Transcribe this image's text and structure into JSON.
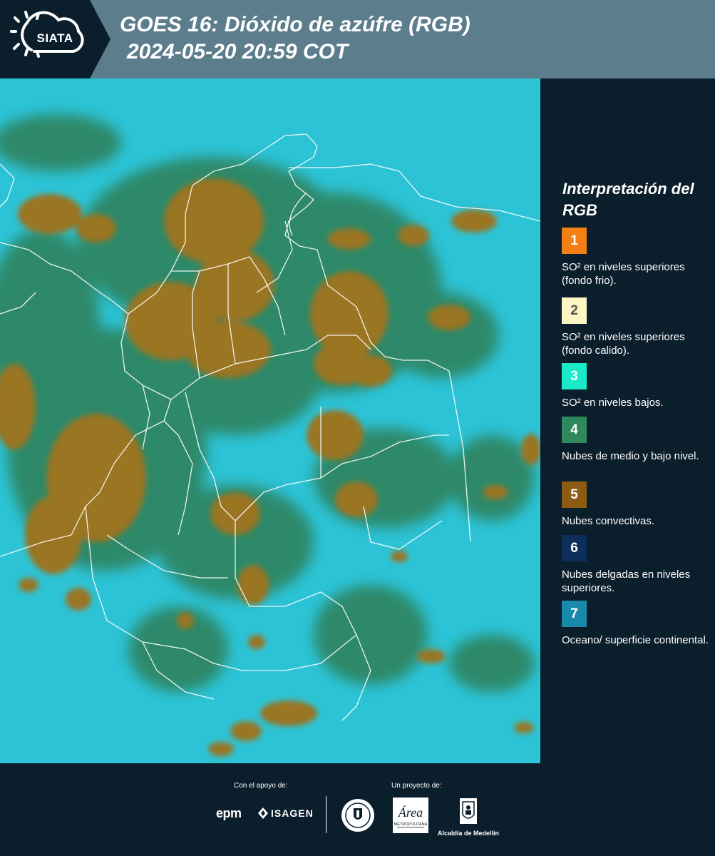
{
  "header": {
    "logo_text": "SIATA",
    "title": "GOES 16: Dióxido de azúfre (RGB)",
    "subtitle": "2024-05-20 20:59 COT"
  },
  "legend": {
    "title": "Interpretación del RGB",
    "items": [
      {
        "number": "1",
        "label": "SO² en niveles superiores (fondo frio).",
        "color": "#f47f14",
        "text_color": "#ffffff"
      },
      {
        "number": "2",
        "label": "SO² en niveles superiores (fondo calido).",
        "color": "#fbf6c2",
        "text_color": "#555555"
      },
      {
        "number": "3",
        "label": "SO² en niveles bajos.",
        "color": "#19ebc8",
        "text_color": "#ffffff"
      },
      {
        "number": "4",
        "label": "Nubes de medio y bajo nivel.",
        "color": "#2e8a5c",
        "text_color": "#ffffff"
      },
      {
        "number": "5",
        "label": "Nubes convectivas.",
        "color": "#8c5c13",
        "text_color": "#ffffff"
      },
      {
        "number": "6",
        "label": "Nubes delgadas en niveles superiores.",
        "color": "#0d2d5a",
        "text_color": "#ffffff"
      },
      {
        "number": "7",
        "label": "Oceano/ superficie continental.",
        "color": "#1a8aac",
        "text_color": "#ffffff"
      }
    ]
  },
  "map": {
    "colors": {
      "background": "#2cc3d6",
      "convective_cloud": "#9a7422",
      "mid_low_cloud": "#2f7f56",
      "boundary": "#ffffff"
    }
  },
  "footer": {
    "support_caption": "Con el apoyo de:",
    "project_caption": "Un proyecto de:",
    "epm_text": "epm",
    "isagen_text": "ISAGEN",
    "area_text": "Área",
    "area_subtitle": "METROPOLITANA",
    "alcaldia_text": "Alcaldía de Medellín"
  }
}
